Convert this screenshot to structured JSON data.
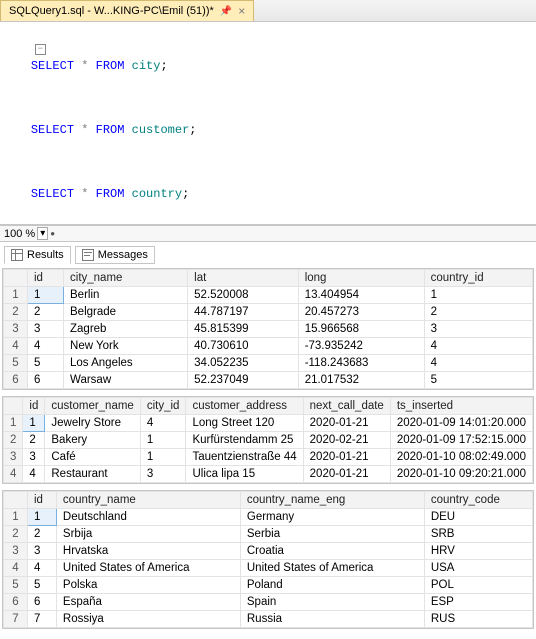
{
  "tab_title": "SQLQuery1.sql - W...KING-PC\\Emil (51))*",
  "sql": {
    "lines": [
      {
        "kw": "SELECT",
        "star": "*",
        "from": "FROM",
        "obj": "city",
        "semi": ";"
      },
      {
        "kw": "SELECT",
        "star": "*",
        "from": "FROM",
        "obj": "customer",
        "semi": ";"
      },
      {
        "kw": "SELECT",
        "star": "*",
        "from": "FROM",
        "obj": "country",
        "semi": ";"
      }
    ]
  },
  "zoom": "100 %",
  "results_tab": "Results",
  "messages_tab": "Messages",
  "grid1": {
    "cols": [
      "id",
      "city_name",
      "lat",
      "long",
      "country_id"
    ],
    "rows": [
      [
        "1",
        "Berlin",
        "52.520008",
        "13.404954",
        "1"
      ],
      [
        "2",
        "Belgrade",
        "44.787197",
        "20.457273",
        "2"
      ],
      [
        "3",
        "Zagreb",
        "45.815399",
        "15.966568",
        "3"
      ],
      [
        "4",
        "New York",
        "40.730610",
        "-73.935242",
        "4"
      ],
      [
        "5",
        "Los Angeles",
        "34.052235",
        "-118.243683",
        "4"
      ],
      [
        "6",
        "Warsaw",
        "52.237049",
        "21.017532",
        "5"
      ]
    ]
  },
  "grid2": {
    "cols": [
      "id",
      "customer_name",
      "city_id",
      "customer_address",
      "next_call_date",
      "ts_inserted"
    ],
    "rows": [
      [
        "1",
        "Jewelry Store",
        "4",
        "Long Street 120",
        "2020-01-21",
        "2020-01-09 14:01:20.000"
      ],
      [
        "2",
        "Bakery",
        "1",
        "Kurfürstendamm 25",
        "2020-02-21",
        "2020-01-09 17:52:15.000"
      ],
      [
        "3",
        "Café",
        "1",
        "Tauentzienstraße 44",
        "2020-01-21",
        "2020-01-10 08:02:49.000"
      ],
      [
        "4",
        "Restaurant",
        "3",
        "Ulica lipa 15",
        "2020-01-21",
        "2020-01-10 09:20:21.000"
      ]
    ]
  },
  "grid3": {
    "cols": [
      "id",
      "country_name",
      "country_name_eng",
      "country_code"
    ],
    "rows": [
      [
        "1",
        "Deutschland",
        "Germany",
        "DEU"
      ],
      [
        "2",
        "Srbija",
        "Serbia",
        "SRB"
      ],
      [
        "3",
        "Hrvatska",
        "Croatia",
        "HRV"
      ],
      [
        "4",
        "United States of America",
        "United States of America",
        "USA"
      ],
      [
        "5",
        "Polska",
        "Poland",
        "POL"
      ],
      [
        "6",
        "España",
        "Spain",
        "ESP"
      ],
      [
        "7",
        "Rossiya",
        "Russia",
        "RUS"
      ]
    ]
  }
}
